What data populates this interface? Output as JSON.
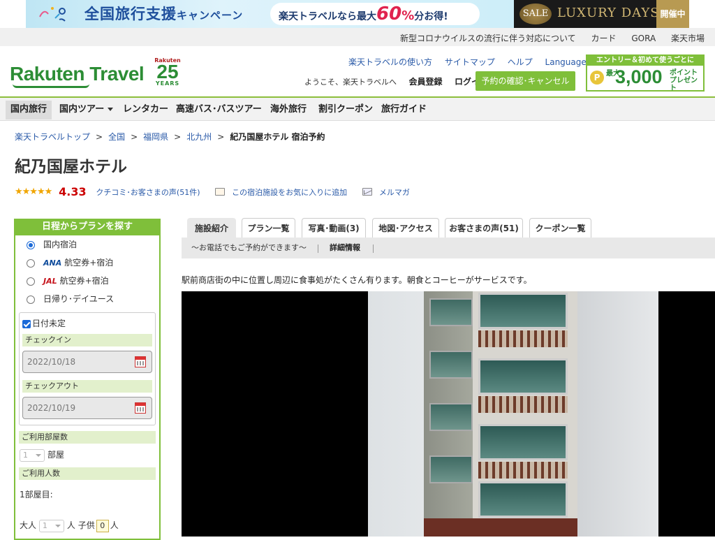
{
  "promo": {
    "title_main": "全国旅行支援",
    "title_sub": "キャンペーン",
    "pill_prefix": "楽天トラベルなら最大",
    "pill_big": "60",
    "pill_percent": "%",
    "pill_suffix": "分お得!",
    "sale": "SALE",
    "luxury": "LUXURY DAYS",
    "open": "開催中"
  },
  "utility_links": [
    "新型コロナウイルスの流行に伴う対応について",
    "カード",
    "GORA",
    "楽天市場"
  ],
  "header": {
    "logo": "Rakuten Travel",
    "years_brand": "Rakuten",
    "years_num": "25",
    "years_label": "YEARS",
    "links": [
      "楽天トラベルの使い方",
      "サイトマップ",
      "ヘルプ"
    ],
    "languages": "Languages",
    "welcome": "ようこそ、楽天トラベルへ",
    "register": "会員登録",
    "login": "ログイン",
    "reserve_button": "予約の確認･キャンセル",
    "entry_top": "エントリー＆初めて使うごとに",
    "entry_coin": "P",
    "entry_small": "最大",
    "entry_num": "3,000",
    "entry_pt": "ポイント\nプレゼント"
  },
  "nav": [
    "国内旅行",
    "国内ツアー",
    "レンタカー",
    "高速バス･バスツアー",
    "海外旅行",
    "割引クーポン",
    "旅行ガイド"
  ],
  "breadcrumb": [
    "楽天トラベルトップ",
    "全国",
    "福岡県",
    "北九州",
    "紀乃国屋ホテル 宿泊予約"
  ],
  "breadcrumb_sep": ">",
  "hotel": {
    "name": "紀乃国屋ホテル",
    "stars": "★★★★★",
    "score": "4.33",
    "reviews_link": "クチコミ･お客さまの声(51件)",
    "favorite_link": "この宿泊施設をお気に入りに追加",
    "mail_link": "メルマガ",
    "description": "駅前商店街の中に位置し周辺に食事処がたくさん有ります。朝食とコーヒーがサービスです。"
  },
  "search_panel": {
    "title": "日程からプランを探す",
    "options": [
      {
        "label": "国内宿泊",
        "badge": "",
        "selected": true
      },
      {
        "label": "航空券+宿泊",
        "badge": "ANA",
        "selected": false
      },
      {
        "label": "航空券+宿泊",
        "badge": "JAL",
        "selected": false
      },
      {
        "label": "日帰り･デイユース",
        "badge": "",
        "selected": false
      }
    ],
    "date_undecided": "日付未定",
    "checkin_label": "チェックイン",
    "checkin_value": "2022/10/18",
    "checkout_label": "チェックアウト",
    "checkout_value": "2022/10/19",
    "rooms_label": "ご利用部屋数",
    "rooms_value": "1",
    "rooms_unit": "部屋",
    "people_label": "ご利用人数",
    "room1_label": "1部屋目:",
    "adult_label": "大人",
    "adult_value": "1",
    "person_unit": "人",
    "child_label": "子供",
    "child_value": "0"
  },
  "tabs": [
    "施設紹介",
    "プラン一覧",
    "写真･動画(3)",
    "地図･アクセス",
    "お客さまの声(51)",
    "クーポン一覧"
  ],
  "subbar": {
    "left": "〜お電話でもご予約ができます〜",
    "detail": "詳細情報"
  }
}
